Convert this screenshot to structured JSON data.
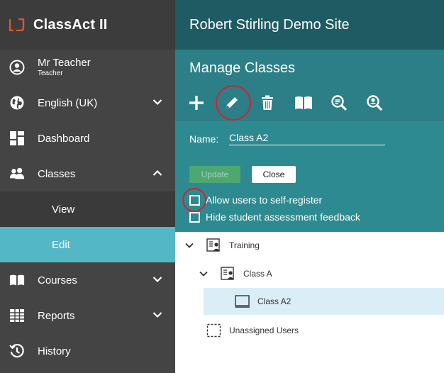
{
  "app": {
    "name": "ClassAct II"
  },
  "user": {
    "name": "Mr Teacher",
    "role": "Teacher"
  },
  "nav": {
    "language": "English (UK)",
    "dashboard": "Dashboard",
    "classes": "Classes",
    "classes_sub": [
      "View",
      "Edit"
    ],
    "courses": "Courses",
    "reports": "Reports",
    "history": "History"
  },
  "header": {
    "site_title": "Robert Stirling Demo Site"
  },
  "panel": {
    "title": "Manage Classes",
    "name_label": "Name:",
    "name_value": "Class A2",
    "update_label": "Update",
    "close_label": "Close",
    "allow_self_register": "Allow users to self-register",
    "hide_feedback": "Hide student assessment feedback"
  },
  "tree": {
    "items": [
      {
        "label": "Training"
      },
      {
        "label": "Class A"
      },
      {
        "label": "Class A2"
      },
      {
        "label": "Unassigned Users"
      }
    ]
  },
  "colors": {
    "sidebar": "#444444",
    "accent": "#54b7c6",
    "header": "#1e5b62",
    "panel": "#2c7f87",
    "highlight": "#d4212e",
    "logo": "#e8542a"
  }
}
